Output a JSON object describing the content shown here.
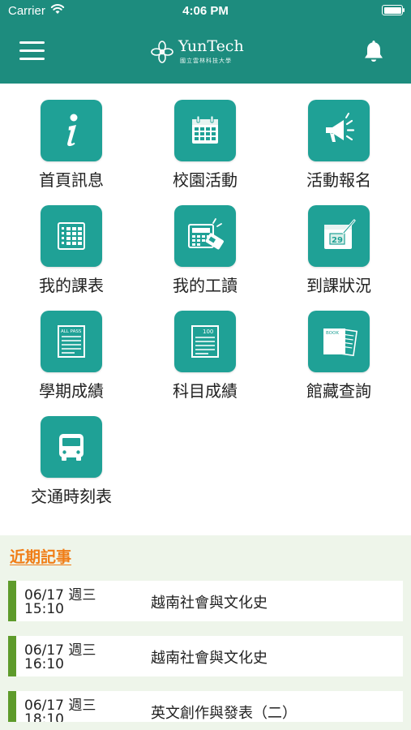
{
  "status_bar": {
    "carrier": "Carrier",
    "time": "4:06 PM",
    "battery_level": 1.0
  },
  "header": {
    "logo_name": "YunTech",
    "logo_subtitle": "國立雲林科技大學",
    "menu_icon": "hamburger-menu-icon",
    "notification_icon": "bell-icon"
  },
  "colors": {
    "primary": "#1d8c7e",
    "tile": "#1fa196",
    "accent_orange": "#f07d16",
    "event_bar": "#5e9b2b",
    "section_bg": "#eef5ea"
  },
  "menu": [
    {
      "label": "首頁訊息",
      "icon": "info-icon"
    },
    {
      "label": "校園活動",
      "icon": "calendar-icon"
    },
    {
      "label": "活動報名",
      "icon": "megaphone-icon"
    },
    {
      "label": "我的課表",
      "icon": "timetable-icon"
    },
    {
      "label": "我的工讀",
      "icon": "calculator-card-icon"
    },
    {
      "label": "到課狀況",
      "icon": "attendance-calendar-icon"
    },
    {
      "label": "學期成績",
      "icon": "report-all-pass-icon",
      "icon_text": "ALL PASS"
    },
    {
      "label": "科目成績",
      "icon": "score-100-icon",
      "icon_text": "100"
    },
    {
      "label": "館藏查詢",
      "icon": "library-books-icon",
      "icon_text": "BOOK"
    },
    {
      "label": "交通時刻表",
      "icon": "bus-icon"
    }
  ],
  "recent": {
    "title": "近期記事",
    "events": [
      {
        "date": "06/17 週三",
        "time": "15:10",
        "title": "越南社會與文化史"
      },
      {
        "date": "06/17 週三",
        "time": "16:10",
        "title": "越南社會與文化史"
      },
      {
        "date": "06/17 週三",
        "time": "18:10",
        "title": "英文創作與發表（二）"
      }
    ]
  }
}
